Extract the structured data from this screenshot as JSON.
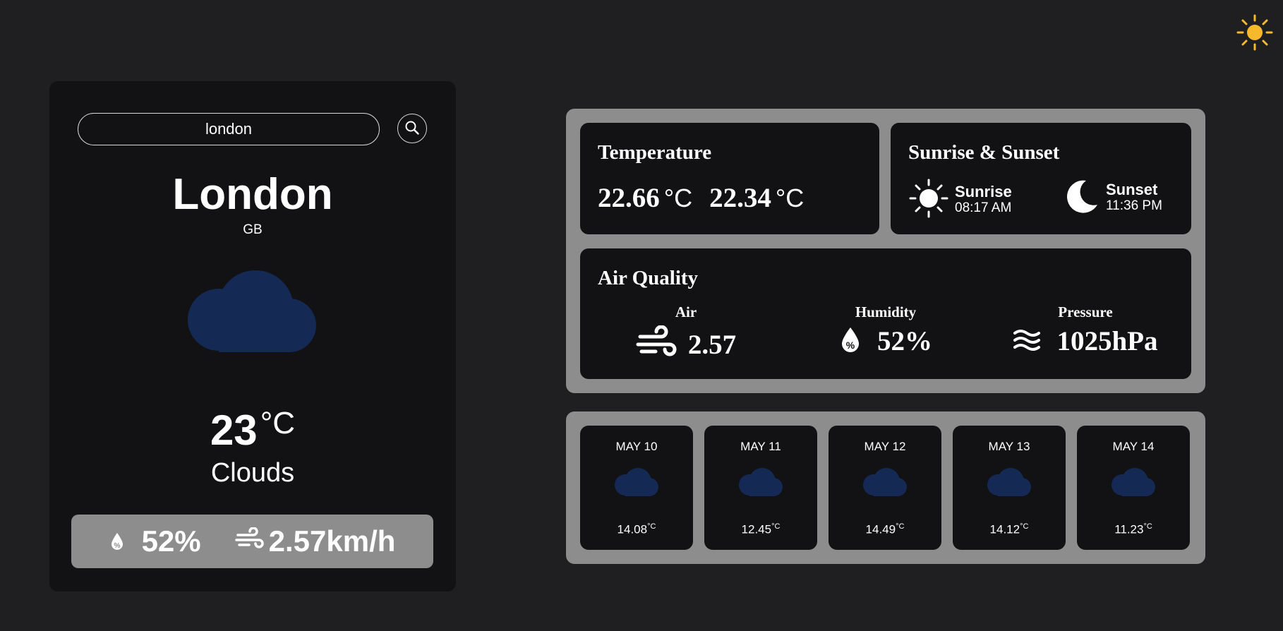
{
  "search": {
    "value": "london"
  },
  "location": {
    "city": "London",
    "country": "GB"
  },
  "current": {
    "temp": "23",
    "unit": "°C",
    "condition": "Clouds",
    "humidity": "52%",
    "wind": "2.57km/h"
  },
  "temperature_card": {
    "title": "Temperature",
    "values": [
      "22.66",
      "22.34"
    ],
    "unit": "°C"
  },
  "sun_card": {
    "title": "Sunrise & Sunset",
    "sunrise_label": "Sunrise",
    "sunrise_time": "08:17 AM",
    "sunset_label": "Sunset",
    "sunset_time": "11:36 PM"
  },
  "air_card": {
    "title": "Air Quality",
    "items": [
      {
        "label": "Air",
        "value": "2.57"
      },
      {
        "label": "Humidity",
        "value": "52%"
      },
      {
        "label": "Pressure",
        "value": "1025hPa"
      }
    ]
  },
  "forecast": [
    {
      "date": "MAY 10",
      "temp": "14.08",
      "unit": "°C"
    },
    {
      "date": "MAY 11",
      "temp": "12.45",
      "unit": "°C"
    },
    {
      "date": "MAY 12",
      "temp": "14.49",
      "unit": "°C"
    },
    {
      "date": "MAY 13",
      "temp": "14.12",
      "unit": "°C"
    },
    {
      "date": "MAY 14",
      "temp": "11.23",
      "unit": "°C"
    }
  ],
  "colors": {
    "background": "#1f1f21",
    "card": "#121214",
    "panel": "#8d8d8d",
    "cloud": "#142a55",
    "sun_toggle": "#f6b92b"
  },
  "icons": [
    "sun-icon",
    "search-icon",
    "cloud-icon",
    "humidity-drop-icon",
    "wind-icon",
    "moon-icon",
    "pressure-waves-icon"
  ]
}
